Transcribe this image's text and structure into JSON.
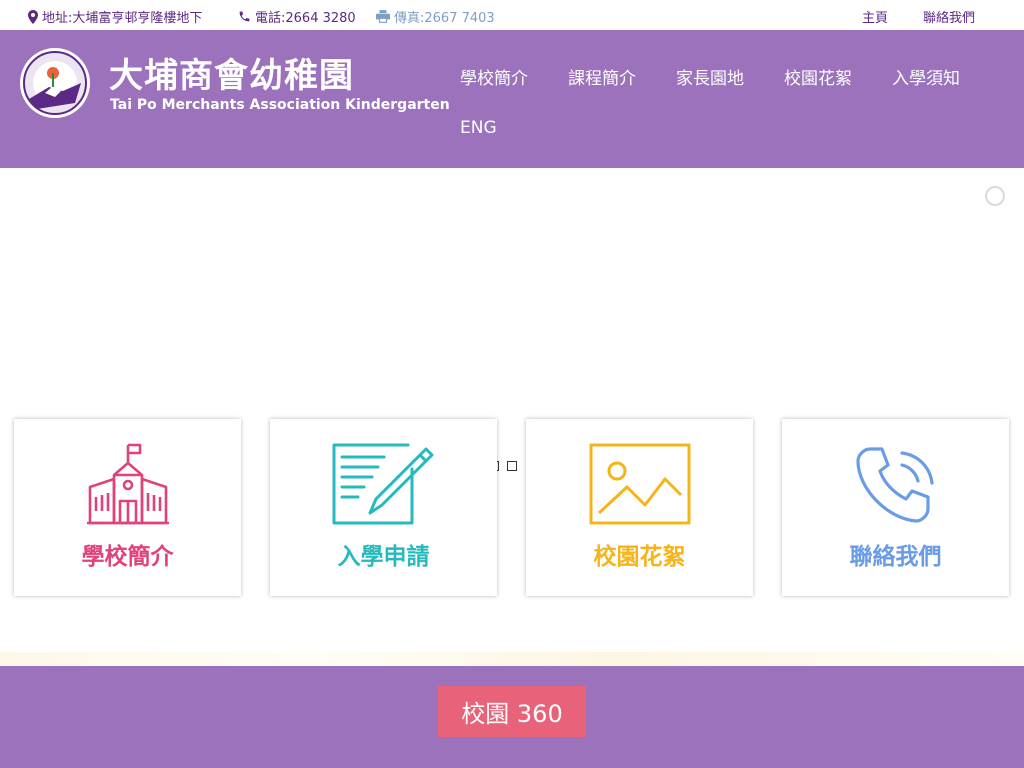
{
  "topbar": {
    "address": "地址:大埔富亨邨亨隆樓地下",
    "phone": "電話:2664 3280",
    "fax": "傳真:2667 7403",
    "home": "主頁",
    "contact": "聯絡我們"
  },
  "header": {
    "name_cn": "大埔商會幼稚園",
    "name_en": "Tai Po Merchants Association Kindergarten",
    "nav": [
      "學校簡介",
      "課程簡介",
      "家長園地",
      "校園花絮",
      "入學須知",
      "ENG"
    ]
  },
  "cards": [
    {
      "label": "學校簡介",
      "icon": "school-building-icon",
      "color": "#e0437b"
    },
    {
      "label": "入學申請",
      "icon": "document-pen-icon",
      "color": "#26b9be"
    },
    {
      "label": "校園花絮",
      "icon": "picture-icon",
      "color": "#f5b41a"
    },
    {
      "label": "聯絡我們",
      "icon": "phone-icon",
      "color": "#6a9ce6"
    }
  ],
  "footer": {
    "button": "校園 360"
  },
  "colors": {
    "header_bg": "#9b72bb",
    "topbar_text": "#5b2a86",
    "button_bg": "#e8627a"
  }
}
